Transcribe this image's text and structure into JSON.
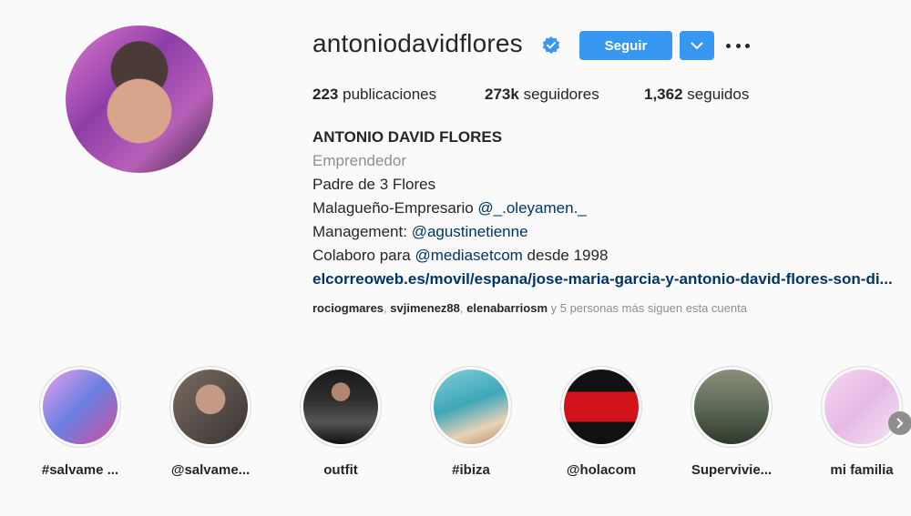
{
  "profile": {
    "username": "antoniodavidflores",
    "follow_label": "Seguir",
    "stats": {
      "posts_count": "223",
      "posts_label": "publicaciones",
      "followers_count": "273k",
      "followers_label": "seguidores",
      "following_count": "1,362",
      "following_label": "seguidos"
    },
    "bio": {
      "name": "ANTONIO DAVID FLORES",
      "category": "Emprendedor",
      "line1": "Padre de 3 Flores",
      "line2_prefix": "Malagueño-Empresario ",
      "line2_mention": "@_.oleyamen._",
      "line3_prefix": "Management: ",
      "line3_mention": "@agustinetienne",
      "line4_prefix": "Colaboro para ",
      "line4_mention": "@mediasetcom",
      "line4_suffix": " desde 1998",
      "url": "elcorreoweb.es/movil/espana/jose-maria-garcia-y-antonio-david-flores-son-di..."
    },
    "followed_by": {
      "user1": "rociogmares",
      "user2": "svjimenez88",
      "user3": "elenabarriosm",
      "suffix": " y 5 personas más siguen esta cuenta"
    }
  },
  "highlights": [
    {
      "label": "#salvame ..."
    },
    {
      "label": "@salvame..."
    },
    {
      "label": "outfit"
    },
    {
      "label": "#ibiza"
    },
    {
      "label": "@holacom"
    },
    {
      "label": "Supervivie..."
    },
    {
      "label": "mi familia"
    }
  ],
  "colors": {
    "accent": "#3897f0",
    "link": "#003569",
    "muted": "#8e8e8e"
  }
}
